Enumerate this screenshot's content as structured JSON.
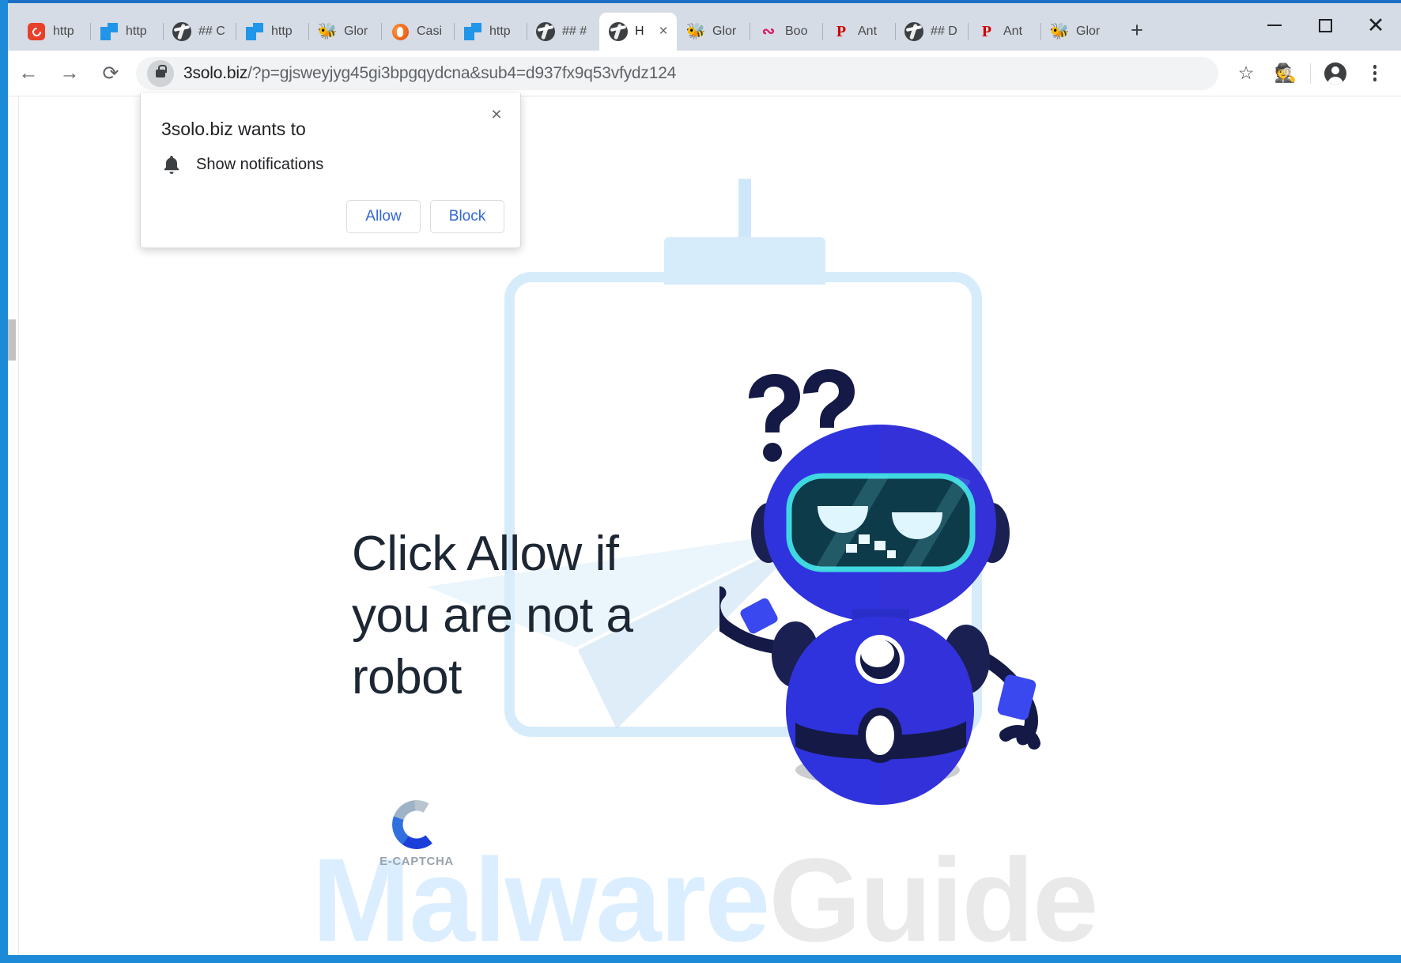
{
  "window": {
    "minimize_label": "Minimize",
    "maximize_label": "Maximize",
    "close_label": "Close",
    "new_tab_label": "+"
  },
  "tabs": [
    {
      "title": "http",
      "favicon": "opera-icon",
      "active": false
    },
    {
      "title": "http",
      "favicon": "blue-squares-icon",
      "active": false
    },
    {
      "title": "## C",
      "favicon": "globe-icon",
      "active": false
    },
    {
      "title": "http",
      "favicon": "blue-squares-icon",
      "active": false
    },
    {
      "title": "Glor",
      "favicon": "bee-icon",
      "active": false
    },
    {
      "title": "Casi",
      "favicon": "firefox-icon",
      "active": false
    },
    {
      "title": "http",
      "favicon": "blue-squares-icon",
      "active": false
    },
    {
      "title": "## #",
      "favicon": "globe-icon",
      "active": false
    },
    {
      "title": "H",
      "favicon": "globe-icon",
      "active": true,
      "close_label": "×"
    },
    {
      "title": "Glor",
      "favicon": "bee-icon",
      "active": false
    },
    {
      "title": "Boo",
      "favicon": "wave-icon",
      "active": false
    },
    {
      "title": "Ant",
      "favicon": "p-icon",
      "active": false
    },
    {
      "title": "## D",
      "favicon": "globe-icon",
      "active": false
    },
    {
      "title": "Ant",
      "favicon": "p-icon",
      "active": false
    },
    {
      "title": "Glor",
      "favicon": "bee-icon",
      "active": false
    }
  ],
  "toolbar": {
    "back_label": "←",
    "forward_label": "→",
    "reload_label": "⟳",
    "bookmark_label": "☆",
    "extension_label": "detective-extension",
    "profile_label": "profile",
    "menu_label": "menu"
  },
  "omnibox": {
    "security_icon": "lock-icon",
    "host": "3solo.biz",
    "path": "/?p=gjsweyjyg45gi3bpgqydcna&sub4=d937fx9q53vfydz124",
    "full_url": "3solo.biz/?p=gjsweyjyg45gi3bpgqydcna&sub4=d937fx9q53vfydz124"
  },
  "permission_dialog": {
    "title": "3solo.biz wants to",
    "permission_icon": "bell-icon",
    "permission_label": "Show notifications",
    "allow_label": "Allow",
    "block_label": "Block",
    "close_label": "×"
  },
  "page": {
    "headline": "Click Allow if you are not a robot",
    "captcha_brand": "E-CAPTCHA",
    "robot_thought": "??",
    "watermark_primary": "Malware",
    "watermark_secondary": "Guide"
  },
  "colors": {
    "accent_blue": "#3367d6",
    "frame_blue": "#1c8ad6",
    "robot_blue": "#2b2fd8",
    "robot_dark": "#141a45",
    "robot_screen_edge": "#3fd8e0",
    "bg_bell": "#d7ecfb",
    "headline_text": "#1d2733",
    "watermark_blue": "#dbeeff",
    "watermark_gray": "#e9e9e9"
  }
}
